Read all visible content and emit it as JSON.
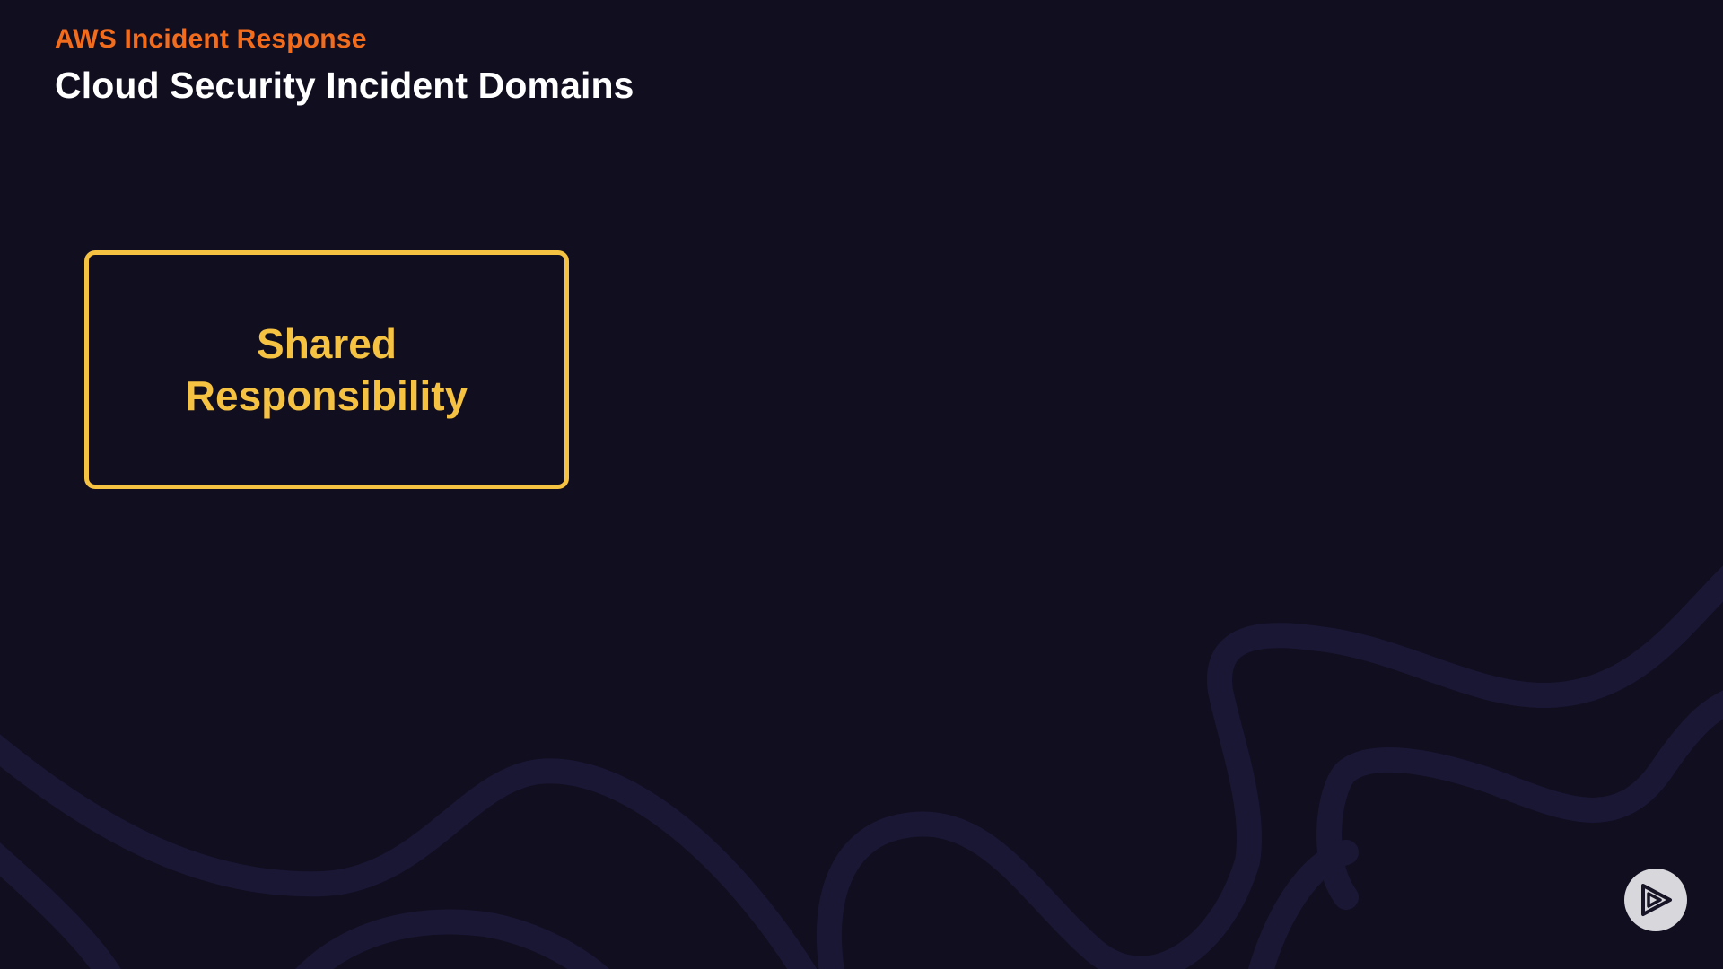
{
  "header": {
    "course_title": "AWS Incident Response",
    "slide_title": "Cloud Security Incident Domains"
  },
  "domain_card": {
    "label": "Shared Responsibility"
  },
  "colors": {
    "background": "#110e20",
    "accent_orange": "#f26c1d",
    "accent_yellow": "#f5c242",
    "title_white": "#ffffff",
    "wave": "#1a1735"
  },
  "icons": {
    "logo": "pluralsight-play-icon"
  }
}
